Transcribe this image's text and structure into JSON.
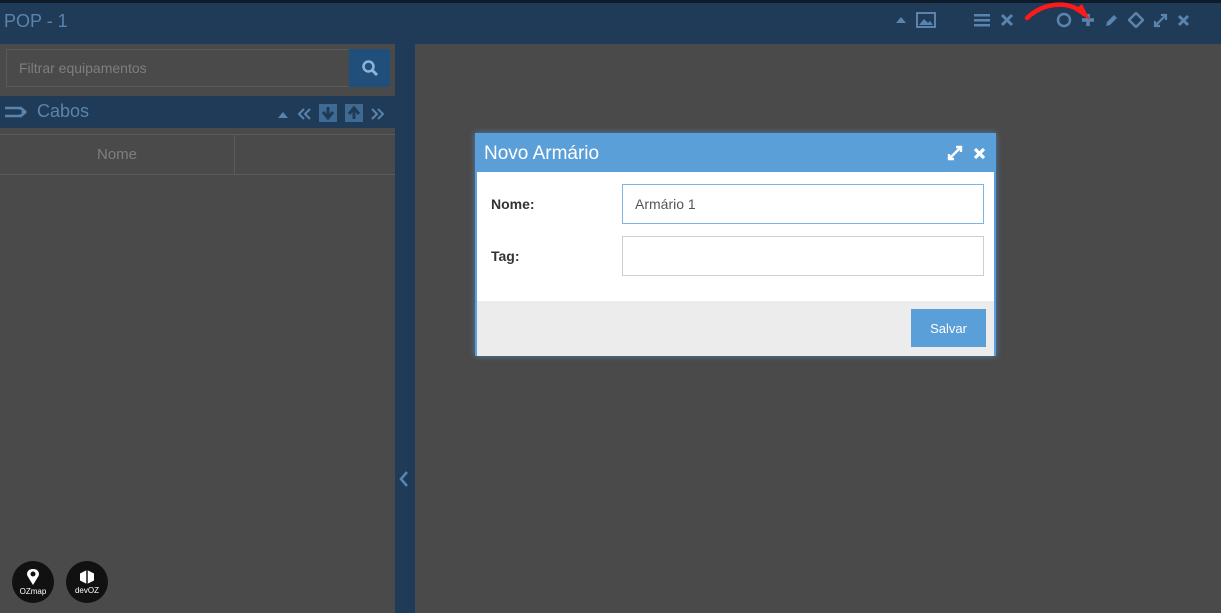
{
  "window": {
    "title": "POP - 1"
  },
  "left_panel": {
    "filter": {
      "placeholder": "Filtrar equipamentos",
      "value": ""
    },
    "section": {
      "label": "Cabos"
    },
    "table": {
      "columns": [
        "Nome",
        ""
      ]
    }
  },
  "modal": {
    "title": "Novo Armário",
    "fields": [
      {
        "label": "Nome:",
        "value": "Armário 1"
      },
      {
        "label": "Tag:",
        "value": ""
      }
    ],
    "save_label": "Salvar"
  },
  "logos": {
    "ozmap_caption": "OZmap",
    "devoz_caption": "devOZ"
  },
  "colors": {
    "titlebar": "#1f3b57",
    "modal_header": "#5b9fd8",
    "annotation_arrow": "#ff1a1a"
  }
}
